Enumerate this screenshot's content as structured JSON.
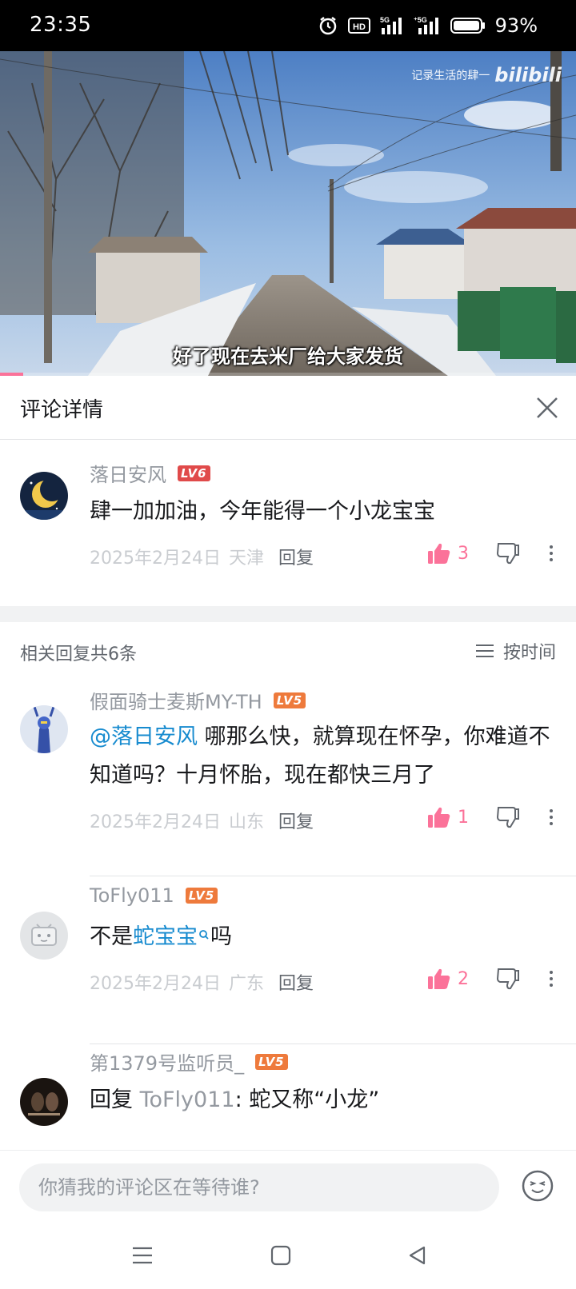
{
  "status_bar": {
    "time": "23:35",
    "battery_text": "93%",
    "icons": [
      "alarm-icon",
      "hd-icon",
      "signal-5g-icon",
      "signal-5g-icon",
      "battery-icon"
    ],
    "battery_level": 0.93
  },
  "video": {
    "watermark_text": "记录生活的肆一",
    "watermark_logo": "bilibili",
    "subtitle": "好了现在去米厂给大家发货",
    "progress": 0.04
  },
  "header": {
    "title": "评论详情",
    "close_icon": "close-icon"
  },
  "root_comment": {
    "user": "落日安风",
    "level": "LV6",
    "text": "肆一加加油，今年能得一个小龙宝宝",
    "date": "2025年2月24日",
    "location": "天津",
    "reply_label": "回复",
    "likes": "3"
  },
  "replies_header": {
    "count_label": "相关回复共6条",
    "sort_label": "按时间"
  },
  "replies": [
    {
      "user": "假面骑士麦斯MY-TH",
      "level": "LV5",
      "mention": "@落日安风",
      "text": " 哪那么快，就算现在怀孕，你难道不知道吗？十月怀胎，现在都快三月了",
      "date": "2025年2月24日",
      "location": "山东",
      "reply_label": "回复",
      "likes": "1"
    },
    {
      "user": "ToFly011",
      "level": "LV5",
      "text_before": "不是",
      "keyword": "蛇宝宝",
      "text_after": "吗",
      "date": "2025年2月24日",
      "location": "广东",
      "reply_label": "回复",
      "likes": "2"
    },
    {
      "user": "第1379号监听员_",
      "level": "LV5",
      "reply_prefix": "回复 ",
      "reply_target": "ToFly011",
      "text": ": 蛇又称“小龙”"
    }
  ],
  "input": {
    "placeholder": "你猜我的评论区在等待谁?"
  },
  "colors": {
    "accent_pink": "#fb7299",
    "link_blue": "#178bcf",
    "lv6": "#e04a4a",
    "lv5": "#ee7a3c"
  }
}
